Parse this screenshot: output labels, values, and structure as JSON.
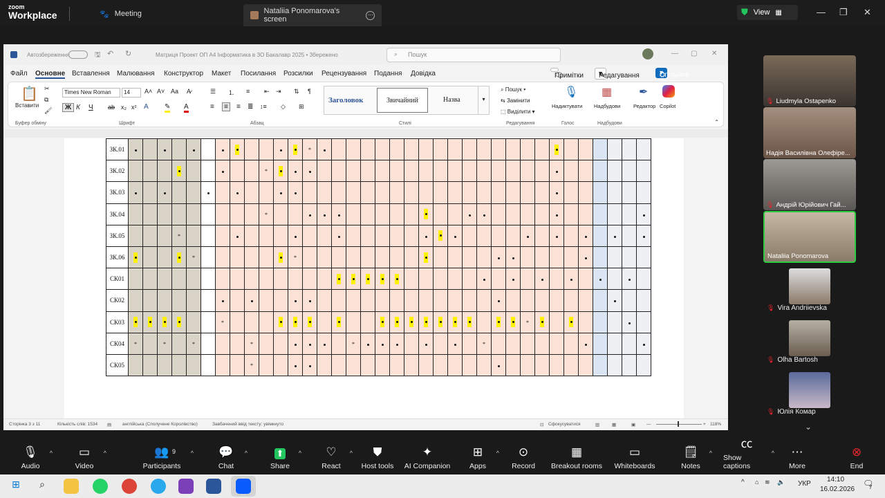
{
  "app": {
    "logo_small": "zoom",
    "logo_big": "Workplace"
  },
  "tabs": [
    {
      "label": "Meeting",
      "icon": "paw-icon"
    },
    {
      "label": "Nataliia Ponomarova's screen",
      "icon": "screen-share-icon"
    }
  ],
  "view_label": "View",
  "word": {
    "autosave": "Автозбереження",
    "doc_title": "Матриця Проект ОП А4 Інформатика в ЗО Бакалавр 2025 • Збережено",
    "search_placeholder": "Пошук",
    "menu": [
      "Файл",
      "Основне",
      "Вставлення",
      "Малювання",
      "Конструктор",
      "Макет",
      "Посилання",
      "Розсилки",
      "Рецензування",
      "Подання",
      "Довідка"
    ],
    "notes_btn": "Примітки",
    "edit_btn": "Редагування",
    "share_btn": "Спільний доступ",
    "paste": "Вставити",
    "font": "Times New Roman",
    "size": "14",
    "styles": [
      "Заголовок",
      "Звичайний",
      "Назва"
    ],
    "find": "Пошук",
    "replace": "Замінити",
    "select": "Виділити",
    "dictate": "Надиктувати",
    "addins": "Надбудови",
    "editor": "Редактор",
    "copilot": "Copilot",
    "groups": [
      "Буфер обміну",
      "Шрифт",
      "Абзац",
      "Стилі",
      "Редагування",
      "Голос",
      "Надбудови"
    ],
    "status": {
      "page": "Сторінка 3 з 11",
      "words": "Кількість слів: 1534",
      "lang": "англійська (Сполучене Королівство)",
      "predict": "Завбачений ввід тексту: увімкнуто",
      "focus": "Сфокусуватися",
      "zoom": "118%"
    }
  },
  "table_rows": [
    {
      "label": "ЗК.01",
      "cells": "..... h...*. .......h...... .....h .....h..."
    },
    {
      "label": "ЗК.02",
      "cells": "....h.*h.*h.. .........h....h...... ..."
    },
    {
      "label": "ЗК.03",
      "cells": ""
    },
    {
      "label": "ЗК.04",
      "cells": ""
    },
    {
      "label": "ЗК.05",
      "cells": ""
    },
    {
      "label": "ЗК.06",
      "cells": ""
    },
    {
      "label": "СК01",
      "cells": ""
    },
    {
      "label": "СК02",
      "cells": ""
    },
    {
      "label": "СК03",
      "cells": ""
    },
    {
      "label": "СК04",
      "cells": ""
    },
    {
      "label": "СК05",
      "cells": ""
    }
  ],
  "participants_video": [
    {
      "name": "Liudmyla Ostapenko",
      "muted": true
    },
    {
      "name": "Надія Василівна Олефіре...",
      "muted": false
    },
    {
      "name": "Андрій Юрійович Гай...",
      "muted": true
    },
    {
      "name": "Nataliia Ponomarova",
      "muted": false,
      "active": true
    }
  ],
  "participants_small": [
    {
      "name": "Vira Andriievska",
      "muted": true
    },
    {
      "name": "Olha Bartosh",
      "muted": true
    },
    {
      "name": "Юлія Комар",
      "muted": true
    }
  ],
  "toolbar": [
    {
      "label": "Audio",
      "icon": "microphone-icon",
      "caret": true
    },
    {
      "label": "Video",
      "icon": "camera-icon",
      "caret": true
    },
    {
      "label": "Participants",
      "icon": "participants-icon",
      "caret": true,
      "count": "9"
    },
    {
      "label": "Chat",
      "icon": "chat-icon",
      "caret": true
    },
    {
      "label": "Share",
      "icon": "share-icon",
      "caret": true
    },
    {
      "label": "React",
      "icon": "heart-icon",
      "caret": true
    },
    {
      "label": "Host tools",
      "icon": "shield-icon"
    },
    {
      "label": "AI Companion",
      "icon": "sparkle-icon"
    },
    {
      "label": "Apps",
      "icon": "apps-icon",
      "caret": true
    },
    {
      "label": "Record",
      "icon": "record-icon"
    },
    {
      "label": "Breakout rooms",
      "icon": "breakout-icon"
    },
    {
      "label": "Whiteboards",
      "icon": "whiteboard-icon"
    },
    {
      "label": "Notes",
      "icon": "notes-icon",
      "caret": true
    },
    {
      "label": "Show captions",
      "icon": "captions-icon",
      "caret": true
    },
    {
      "label": "More",
      "icon": "more-icon"
    },
    {
      "label": "End",
      "icon": "end-icon"
    }
  ],
  "taskbar": {
    "lang": "УКР",
    "time": "14:10",
    "date": "16.02.2026",
    "notif": "7"
  },
  "colors": {
    "accent": "#0b5cff",
    "highlight": "#fff200",
    "end": "#e8262e",
    "active_border": "#2ecc40"
  }
}
